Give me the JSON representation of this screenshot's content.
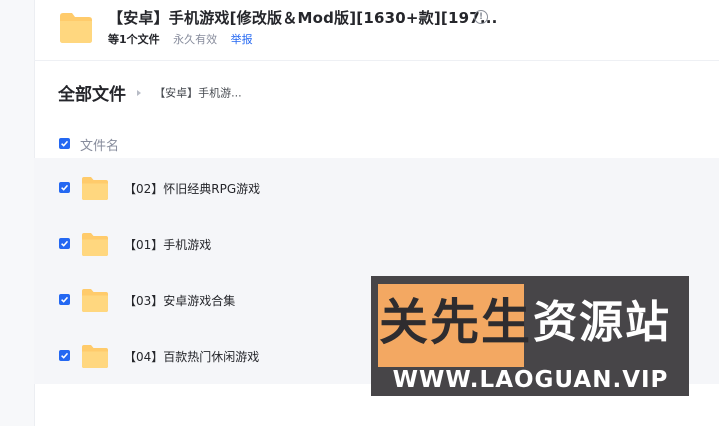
{
  "share": {
    "title": "【安卓】手机游戏[修改版＆Mod版][1630+款][197...",
    "info_icon": "info-circle-icon",
    "owner": "等1个文件",
    "validity": "永久有效",
    "report": "举报"
  },
  "breadcrumb": {
    "root": "全部文件",
    "current": "【安卓】手机游..."
  },
  "list": {
    "column_name": "文件名",
    "select_all_checked": true,
    "items": [
      {
        "name": "【02】怀旧经典RPG游戏",
        "checked": true,
        "icon": "folder-icon"
      },
      {
        "name": "【01】手机游戏",
        "checked": true,
        "icon": "folder-icon"
      },
      {
        "name": "【03】安卓游戏合集",
        "checked": true,
        "icon": "folder-icon"
      },
      {
        "name": "【04】百款热门休闲游戏",
        "checked": true,
        "icon": "folder-icon"
      }
    ]
  },
  "watermark": {
    "text_left": "关先生",
    "text_right": "资源站",
    "url": "WWW.LAOGUAN.VIP"
  },
  "colors": {
    "accent": "#2468f2",
    "folder": "#ffcb6b",
    "watermark_bg": "#474548",
    "watermark_highlight": "#f3a862"
  }
}
